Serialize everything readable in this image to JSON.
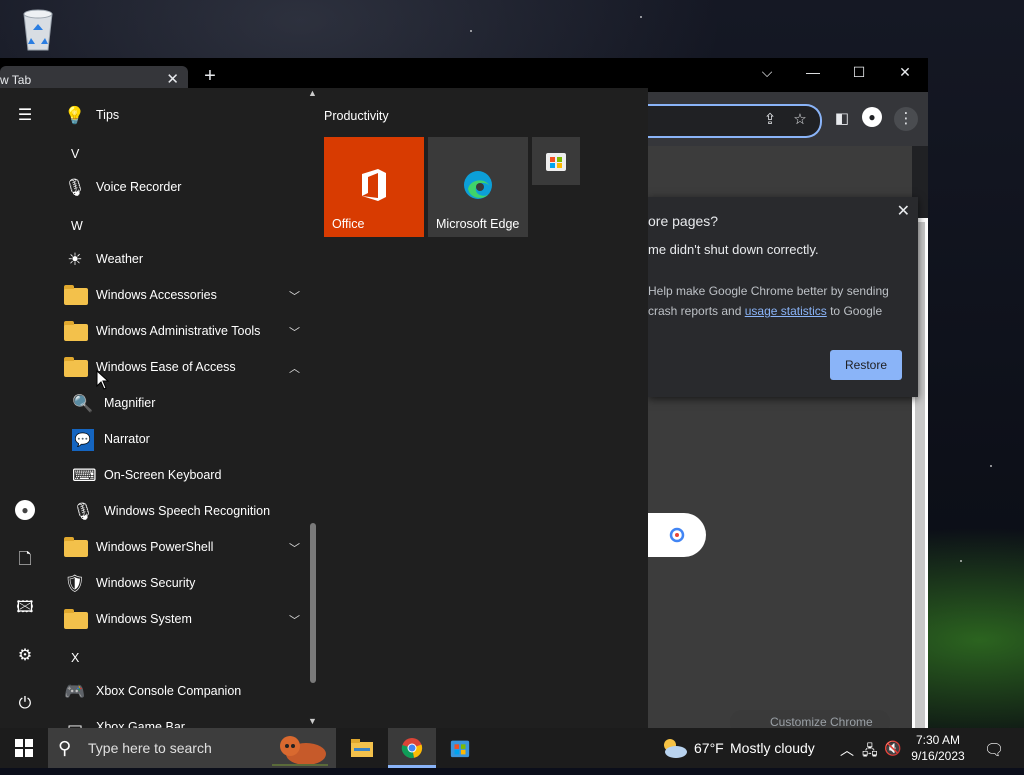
{
  "desktop": {
    "recycle_icon": "recycle-bin-icon"
  },
  "chrome": {
    "tab_title": "w Tab",
    "new_tab_symbol": "+",
    "popup": {
      "heading": "ore pages?",
      "subheading": "me didn't shut down correctly.",
      "para_start": "Help make Google Chrome better by sending crash reports and ",
      "link": "usage statistics",
      "para_end": " to Google",
      "restore_label": "Restore"
    },
    "customize_label": "Customize Chrome"
  },
  "start_menu": {
    "group_title": "Productivity",
    "tiles": [
      {
        "label": "Office",
        "color": "#d83b01"
      },
      {
        "label": "Microsoft Edge",
        "color": "#3a3a3a"
      }
    ],
    "apps": [
      {
        "label": "Tips",
        "icon": "lightbulb-icon"
      },
      {
        "label": "V",
        "kind": "letter"
      },
      {
        "label": "Voice Recorder",
        "icon": "microphone-icon"
      },
      {
        "label": "W",
        "kind": "letter"
      },
      {
        "label": "Weather",
        "icon": "sun-icon"
      },
      {
        "label": "Windows Accessories",
        "icon": "folder-icon",
        "expandable": true
      },
      {
        "label": "Windows Administrative Tools",
        "icon": "folder-icon",
        "expandable": true
      },
      {
        "label": "Windows Ease of Access",
        "icon": "folder-icon",
        "expanded": true
      },
      {
        "label": "Magnifier",
        "icon": "magnifier-icon",
        "sub": true
      },
      {
        "label": "Narrator",
        "icon": "narrator-icon",
        "sub": true
      },
      {
        "label": "On-Screen Keyboard",
        "icon": "keyboard-icon",
        "sub": true
      },
      {
        "label": "Windows Speech Recognition",
        "icon": "microphone-icon",
        "sub": true
      },
      {
        "label": "Windows PowerShell",
        "icon": "folder-icon",
        "expandable": true
      },
      {
        "label": "Windows Security",
        "icon": "shield-icon"
      },
      {
        "label": "Windows System",
        "icon": "folder-icon",
        "expandable": true
      },
      {
        "label": "X",
        "kind": "letter"
      },
      {
        "label": "Xbox Console Companion",
        "icon": "xbox-icon"
      },
      {
        "label": "Xbox Game Bar",
        "icon": "gamebar-icon"
      }
    ]
  },
  "taskbar": {
    "search_placeholder": "Type here to search",
    "weather_temp": "67°F",
    "weather_desc": "Mostly cloudy",
    "time": "7:30 AM",
    "date": "9/16/2023"
  }
}
